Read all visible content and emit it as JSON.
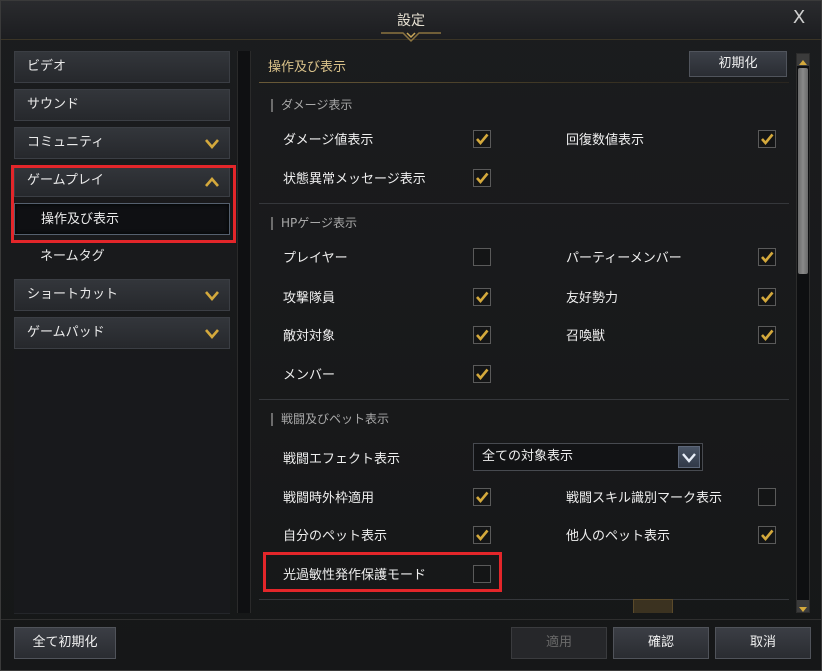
{
  "window": {
    "title": "設定",
    "close_glyph": "X"
  },
  "sidebar": {
    "items": [
      {
        "label": "ビデオ",
        "chevron": "none"
      },
      {
        "label": "サウンド",
        "chevron": "none"
      },
      {
        "label": "コミュニティ",
        "chevron": "down"
      },
      {
        "label": "ゲームプレイ",
        "chevron": "up"
      },
      {
        "label": "操作及び表示",
        "sub": true,
        "active": true
      },
      {
        "label": "ネームタグ",
        "sub": true
      },
      {
        "label": "ショートカット",
        "chevron": "down"
      },
      {
        "label": "ゲームパッド",
        "chevron": "down"
      }
    ]
  },
  "content": {
    "header_title": "操作及び表示",
    "reset_label": "初期化",
    "sections": {
      "damage": {
        "title": "ダメージ表示",
        "options": [
          {
            "label": "ダメージ値表示",
            "checked": true
          },
          {
            "label": "回復数値表示",
            "checked": true
          },
          {
            "label": "状態異常メッセージ表示",
            "checked": true
          }
        ]
      },
      "hp": {
        "title": "HPゲージ表示",
        "options": [
          {
            "label": "プレイヤー",
            "checked": false
          },
          {
            "label": "パーティーメンバー",
            "checked": true
          },
          {
            "label": "攻撃隊員",
            "checked": true
          },
          {
            "label": "友好勢力",
            "checked": true
          },
          {
            "label": "敵対対象",
            "checked": true
          },
          {
            "label": "召喚獣",
            "checked": true
          },
          {
            "label": "メンバー",
            "checked": true
          }
        ]
      },
      "battle": {
        "title": "戦闘及びペット表示",
        "effect_label": "戦闘エフェクト表示",
        "effect_value": "全ての対象表示",
        "options": [
          {
            "label": "戦闘時外枠適用",
            "checked": true
          },
          {
            "label": "戦闘スキル識別マーク表示",
            "checked": false
          },
          {
            "label": "自分のペット表示",
            "checked": true
          },
          {
            "label": "他人のペット表示",
            "checked": true
          },
          {
            "label": "光過敏性発作保護モード",
            "checked": false
          }
        ]
      }
    }
  },
  "footer": {
    "reset_all": "全て初期化",
    "apply": "適用",
    "confirm": "確認",
    "cancel": "取消"
  },
  "colors": {
    "accent": "#d4a93c",
    "highlight": "#e3262a"
  }
}
